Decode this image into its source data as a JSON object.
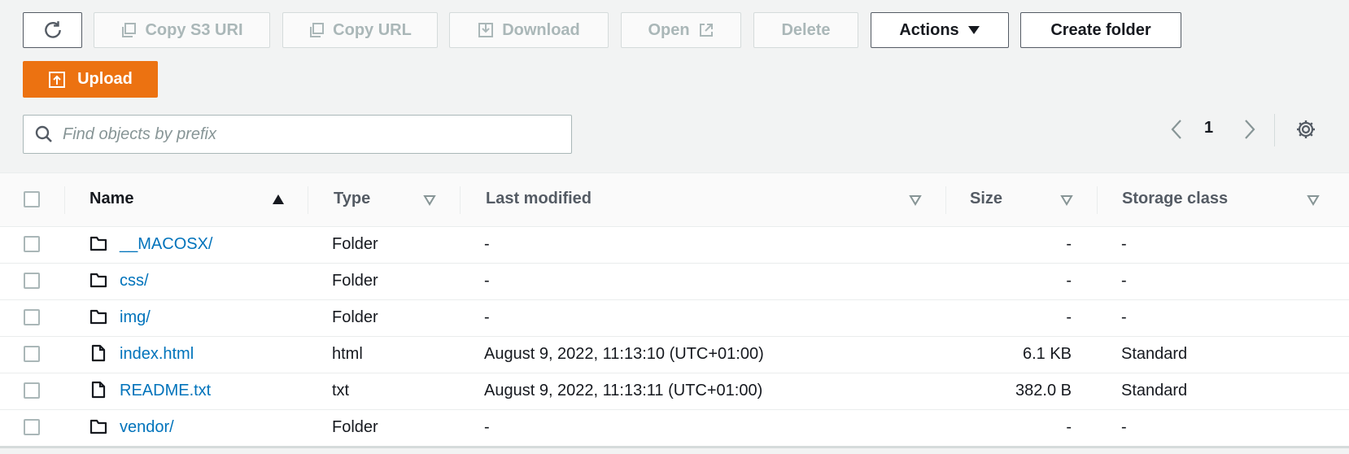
{
  "toolbar": {
    "refresh_icon": "refresh-icon",
    "copy_s3_uri": "Copy S3 URI",
    "copy_url": "Copy URL",
    "download": "Download",
    "open": "Open",
    "delete": "Delete",
    "actions": "Actions",
    "create_folder": "Create folder",
    "upload": "Upload"
  },
  "search": {
    "placeholder": "Find objects by prefix",
    "value": ""
  },
  "pagination": {
    "current_page": "1"
  },
  "table": {
    "headers": {
      "name": "Name",
      "type": "Type",
      "last_modified": "Last modified",
      "size": "Size",
      "storage_class": "Storage class"
    },
    "rows": [
      {
        "icon": "folder-icon",
        "name": "__MACOSX/",
        "type": "Folder",
        "last_modified": "-",
        "size": "-",
        "storage_class": "-"
      },
      {
        "icon": "folder-icon",
        "name": "css/",
        "type": "Folder",
        "last_modified": "-",
        "size": "-",
        "storage_class": "-"
      },
      {
        "icon": "folder-icon",
        "name": "img/",
        "type": "Folder",
        "last_modified": "-",
        "size": "-",
        "storage_class": "-"
      },
      {
        "icon": "file-icon",
        "name": "index.html",
        "type": "html",
        "last_modified": "August 9, 2022, 11:13:10 (UTC+01:00)",
        "size": "6.1 KB",
        "storage_class": "Standard"
      },
      {
        "icon": "file-icon",
        "name": "README.txt",
        "type": "txt",
        "last_modified": "August 9, 2022, 11:13:11 (UTC+01:00)",
        "size": "382.0 B",
        "storage_class": "Standard"
      },
      {
        "icon": "folder-icon",
        "name": "vendor/",
        "type": "Folder",
        "last_modified": "-",
        "size": "-",
        "storage_class": "-"
      }
    ]
  },
  "colors": {
    "accent": "#ec7211",
    "link": "#0073bb",
    "disabled": "#aab7b8"
  }
}
